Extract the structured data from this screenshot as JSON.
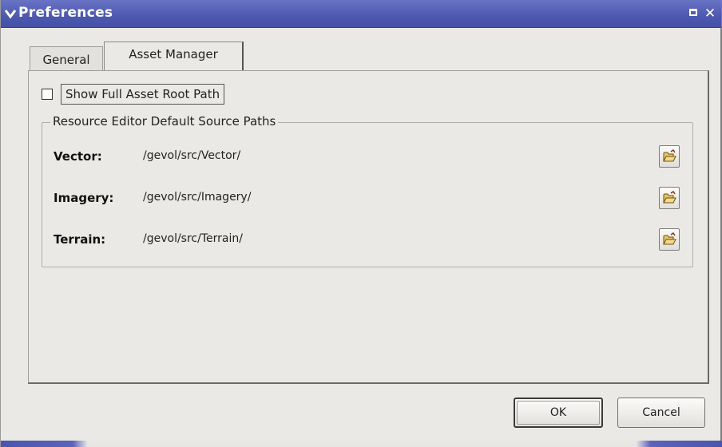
{
  "window": {
    "title": "Preferences",
    "menu_icon": "chevron-down-icon",
    "maximize_icon": "maximize-icon",
    "close_icon": "close-icon"
  },
  "tabs": [
    {
      "label": "General",
      "selected": false
    },
    {
      "label": "Asset Manager",
      "selected": true
    }
  ],
  "asset_manager": {
    "show_full_path": {
      "label": "Show Full Asset Root Path",
      "checked": false
    },
    "group": {
      "title": "Resource Editor Default Source Paths",
      "rows": [
        {
          "label": "Vector:",
          "path": "/gevol/src/Vector/",
          "icon": "folder-open-icon"
        },
        {
          "label": "Imagery:",
          "path": "/gevol/src/Imagery/",
          "icon": "folder-open-icon"
        },
        {
          "label": "Terrain:",
          "path": "/gevol/src/Terrain/",
          "icon": "folder-open-icon"
        }
      ]
    }
  },
  "buttons": {
    "ok": "OK",
    "cancel": "Cancel"
  },
  "colors": {
    "titlebar": "#4d58b0",
    "background": "#ebe9e6"
  }
}
